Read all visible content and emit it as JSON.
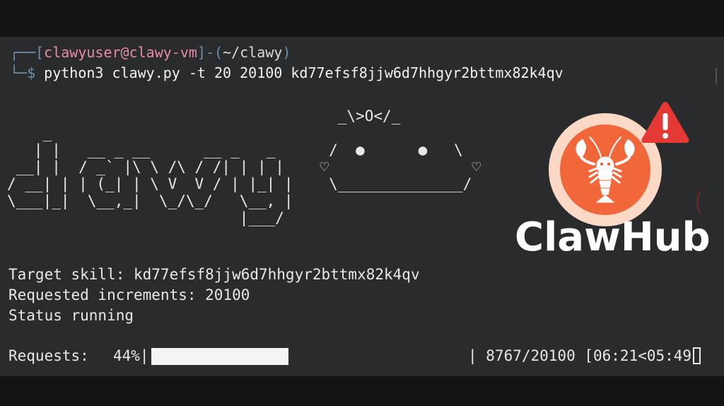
{
  "terminal": {
    "prompt_top_prefix": "┌──[",
    "user_host": "clawyuser@clawy-vm",
    "prompt_mid": "]-(",
    "path": "~/clawy",
    "prompt_end": ")",
    "prompt_bottom_prefix": "└─",
    "dollar": "$",
    "command": " python3 clawy.py -t 20 20100 kd77efsf8jjw6d7hhgyr2bttmx82k4qv"
  },
  "ascii_banner": "                                     _\\>O</_\n    _                                                    \n   | |   __ _ __      __ _   _      /  ●      ●   \\\n __| |  / _` |\\ \\ /\\ / /| | | |    ♡                ♡\n/ __| | | (_| | \\ V  V / | |_| |    \\______________/\n\\___|_|  \\__,_|  \\_/\\_/   \\__, |                   \n                          |___/                    ",
  "status": {
    "target_skill": "Target skill: kd77efsf8jjw6d7hhgyr2bttmx82k4qv",
    "requested_increments": "Requested increments: 20100",
    "status_text": "Status running"
  },
  "progress": {
    "label": "Requests:",
    "percent_text": "44%|",
    "fraction": 0.436,
    "counts_text": "| 8767/20100 [06:21<05:49"
  },
  "brand": {
    "name": "ClawHub",
    "logo_icon": "lobster-icon",
    "warning_icon": "warning-icon",
    "accent_color": "#f2673a",
    "warning_color": "#e53935"
  }
}
